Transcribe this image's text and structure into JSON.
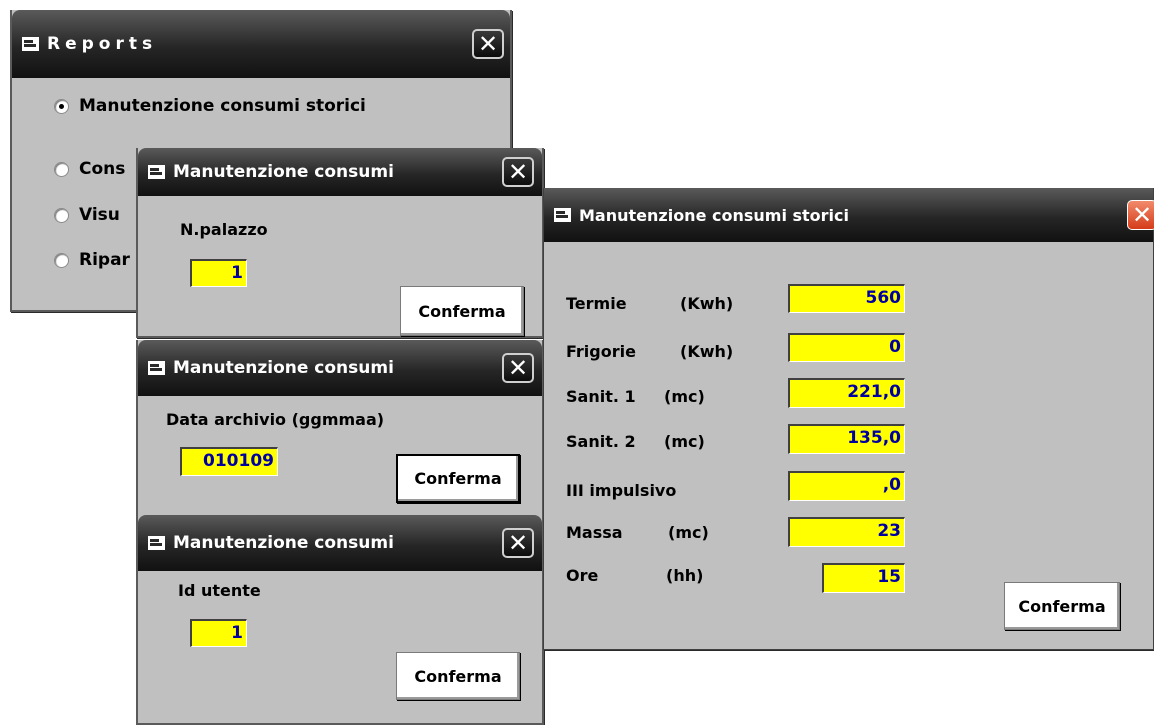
{
  "reports": {
    "title": "Reports",
    "options": [
      {
        "label": "Manutenzione consumi storici",
        "checked": true
      },
      {
        "label": "Cons",
        "checked": false
      },
      {
        "label": "Visu",
        "checked": false
      },
      {
        "label": "Ripar",
        "checked": false
      }
    ]
  },
  "palazzo_dialog": {
    "title": "Manutenzione consumi",
    "label": "N.palazzo",
    "value": "1",
    "confirm": "Conferma"
  },
  "data_dialog": {
    "title": "Manutenzione consumi",
    "label": "Data archivio (ggmmaa)",
    "value": "010109",
    "confirm": "Conferma"
  },
  "utente_dialog": {
    "title": "Manutenzione consumi",
    "label": "Id utente",
    "value": "1",
    "confirm": "Conferma"
  },
  "storici_dialog": {
    "title": "Manutenzione consumi storici",
    "rows": [
      {
        "name": "Termie",
        "unit": "(Kwh)",
        "value": "560"
      },
      {
        "name": "Frigorie",
        "unit": "(Kwh)",
        "value": "0"
      },
      {
        "name": "Sanit. 1",
        "unit": "(mc)",
        "value": "221,0"
      },
      {
        "name": "Sanit. 2",
        "unit": "(mc)",
        "value": "135,0"
      },
      {
        "name": "III impulsivo",
        "unit": "",
        "value": ",0"
      },
      {
        "name": "Massa",
        "unit": "(mc)",
        "value": "23"
      },
      {
        "name": "Ore",
        "unit": "(hh)",
        "value": "15"
      }
    ],
    "confirm": "Conferma"
  },
  "colors": {
    "field": "#ffff00",
    "field_text": "#0000a0",
    "window": "#c0c0c0",
    "close_red": "#d43c18"
  },
  "icons": {
    "window": "window-app-icon",
    "close": "close-icon"
  }
}
